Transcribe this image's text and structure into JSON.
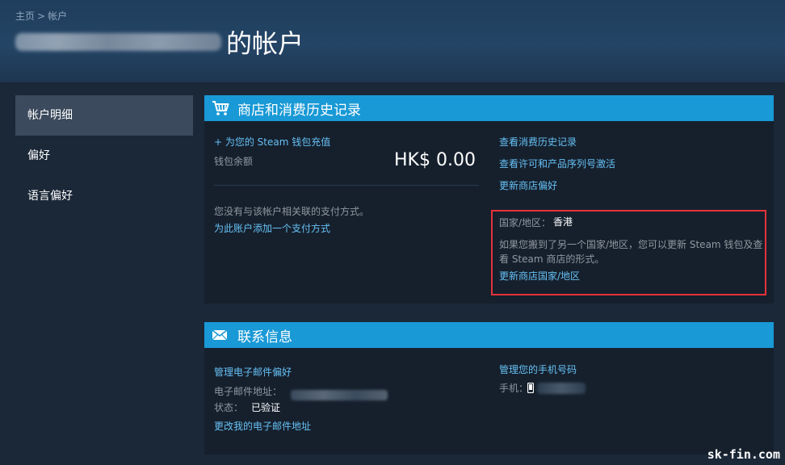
{
  "breadcrumb": {
    "home": "主页",
    "separator": ">",
    "current": "帐户"
  },
  "header": {
    "title": "的帐户"
  },
  "sidebar": {
    "items": [
      {
        "label": "帐户明细"
      },
      {
        "label": "偏好"
      },
      {
        "label": "语言偏好"
      }
    ]
  },
  "store_section": {
    "title": "商店和消费历史记录",
    "add_funds": "+ 为您的 Steam 钱包充值",
    "wallet_label": "钱包余额",
    "wallet_balance": "HK$ 0.00",
    "no_payment_text": "您没有与该帐户相关联的支付方式。",
    "add_payment_link": "为此账户添加一个支付方式",
    "view_history": "查看消费历史记录",
    "view_licenses": "查看许可和产品序列号激活",
    "update_store_prefs": "更新商店偏好",
    "country_label": "国家/地区：",
    "country_value": "香港",
    "country_note_line1": "如果您搬到了另一个国家/地区，您可以更新 Steam 钱包及查",
    "country_note_line2": "看 Steam 商店的形式。",
    "update_country": "更新商店国家/地区"
  },
  "contact_section": {
    "title": "联系信息",
    "manage_email_prefs": "管理电子邮件偏好",
    "email_label": "电子邮件地址：",
    "status_label": "状态：",
    "status_value": "已验证",
    "change_email": "更改我的电子邮件地址",
    "manage_phone": "管理您的手机号码",
    "phone_label": "手机："
  },
  "watermark": "sk-fin.com",
  "colors": {
    "accent": "#1999d6",
    "link": "#66c0f4",
    "highlight_border": "#e5323a"
  }
}
